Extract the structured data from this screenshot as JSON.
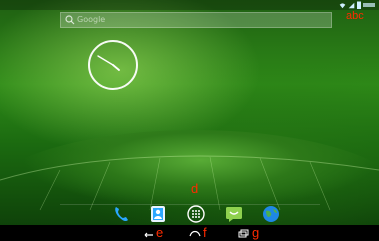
{
  "status_bar": {
    "icons": [
      "wifi-icon",
      "signal-icon",
      "battery-icon",
      "time-text"
    ]
  },
  "search": {
    "placeholder": "Google"
  },
  "labels": {
    "abc": "abc",
    "d": "d",
    "e": "e",
    "f": "f",
    "g": "g"
  },
  "dock": {
    "items": [
      {
        "name": "phone",
        "icon": "phone-icon"
      },
      {
        "name": "contacts",
        "icon": "contacts-icon"
      },
      {
        "name": "all-apps",
        "icon": "apps-grid-icon"
      },
      {
        "name": "messaging",
        "icon": "message-icon"
      },
      {
        "name": "browser",
        "icon": "globe-icon"
      }
    ]
  },
  "nav": {
    "items": [
      {
        "name": "back",
        "icon": "back-icon"
      },
      {
        "name": "home",
        "icon": "home-icon"
      },
      {
        "name": "recents",
        "icon": "recent-apps-icon"
      }
    ]
  },
  "colors": {
    "annotation": "#ff2b00",
    "accent_blue": "#2aa7ff",
    "green": "#8fd14f"
  }
}
